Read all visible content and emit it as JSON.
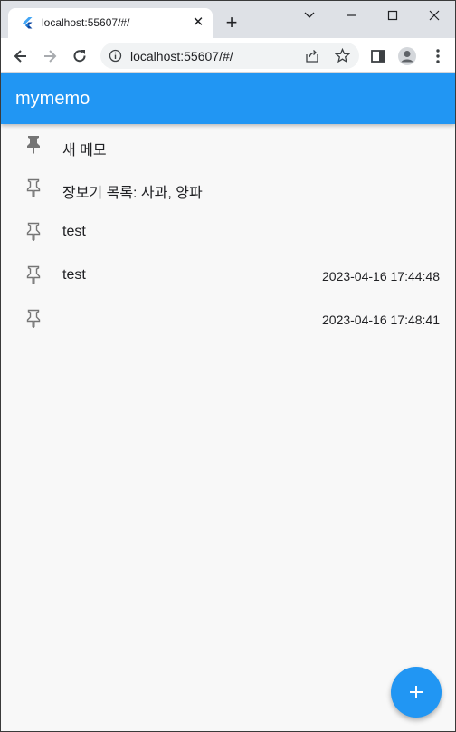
{
  "browser": {
    "tab": {
      "title": "localhost:55607/#/",
      "favicon": "flutter-icon"
    },
    "address_bar": {
      "url": "localhost:55607/#/"
    }
  },
  "app": {
    "title": "mymemo",
    "accent_color": "#2196f3"
  },
  "memos": [
    {
      "title": "새 메모",
      "date": "",
      "pinned": true
    },
    {
      "title": "장보기 목록: 사과, 양파",
      "date": "",
      "pinned": false
    },
    {
      "title": "test",
      "date": "",
      "pinned": false
    },
    {
      "title": "test",
      "date": "2023-04-16 17:44:48",
      "pinned": false
    },
    {
      "title": "",
      "date": "2023-04-16 17:48:41",
      "pinned": false
    }
  ],
  "fab": {
    "icon": "add-icon"
  }
}
